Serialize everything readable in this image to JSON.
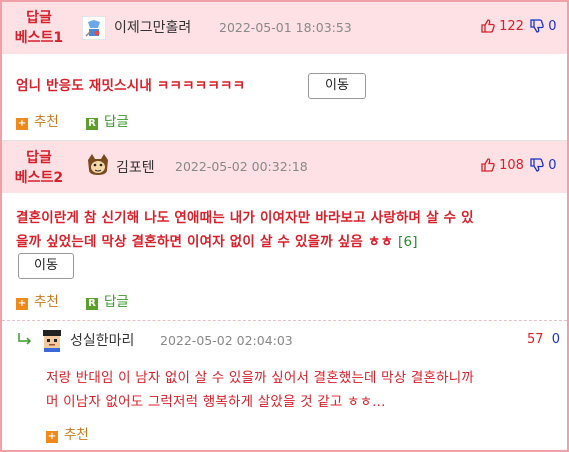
{
  "posts": [
    {
      "best_label": "답글\n베스트1",
      "nick": "이제그만홀려",
      "date": "2022-05-01 18:03:53",
      "up": "122",
      "down": "0",
      "text": "엄니 반응도 재밋스시내 ㅋㅋㅋㅋㅋㅋㅋ",
      "move_label": "이동",
      "recommend_label": "추천",
      "reply_label": "답글"
    },
    {
      "best_label": "답글\n베스트2",
      "nick": "김포텐",
      "date": "2022-05-02 00:32:18",
      "up": "108",
      "down": "0",
      "text_line1": "결혼이란게 참 신기해 나도 연애때는 내가 이여자만 바라보고 사랑하며 살 수 있",
      "text_line2": "을까 싶었는데 막상 결혼하면 이여자 없이 살 수 있을까 싶음 ㅎㅎ",
      "reply_count": "[6]",
      "move_label": "이동",
      "recommend_label": "추천",
      "reply_label": "답글"
    }
  ],
  "reply": {
    "nick": "성실한마리",
    "date": "2022-05-02 02:04:03",
    "up": "57",
    "down": "0",
    "text_line1": "저랑 반대임 이 남자 없이 살 수 있을까 싶어서 결혼했는데 막상 결혼하니까",
    "text_line2": "머 이남자 없어도 그럭저럭 행복하게 살았을 것 같고 ㅎㅎ...",
    "recommend_label": "추천"
  },
  "icons": {
    "recommend": "+",
    "reply": "R",
    "reply_arrow": "reply-arrow-icon"
  },
  "colors": {
    "accent_red": "#d8202a",
    "down_blue": "#1a32c8",
    "best_bg": "#fde1e5",
    "border_pink": "#f0a0a8",
    "reply_green": "#3a9a2a",
    "recommend_orange": "#ef8a1a"
  }
}
